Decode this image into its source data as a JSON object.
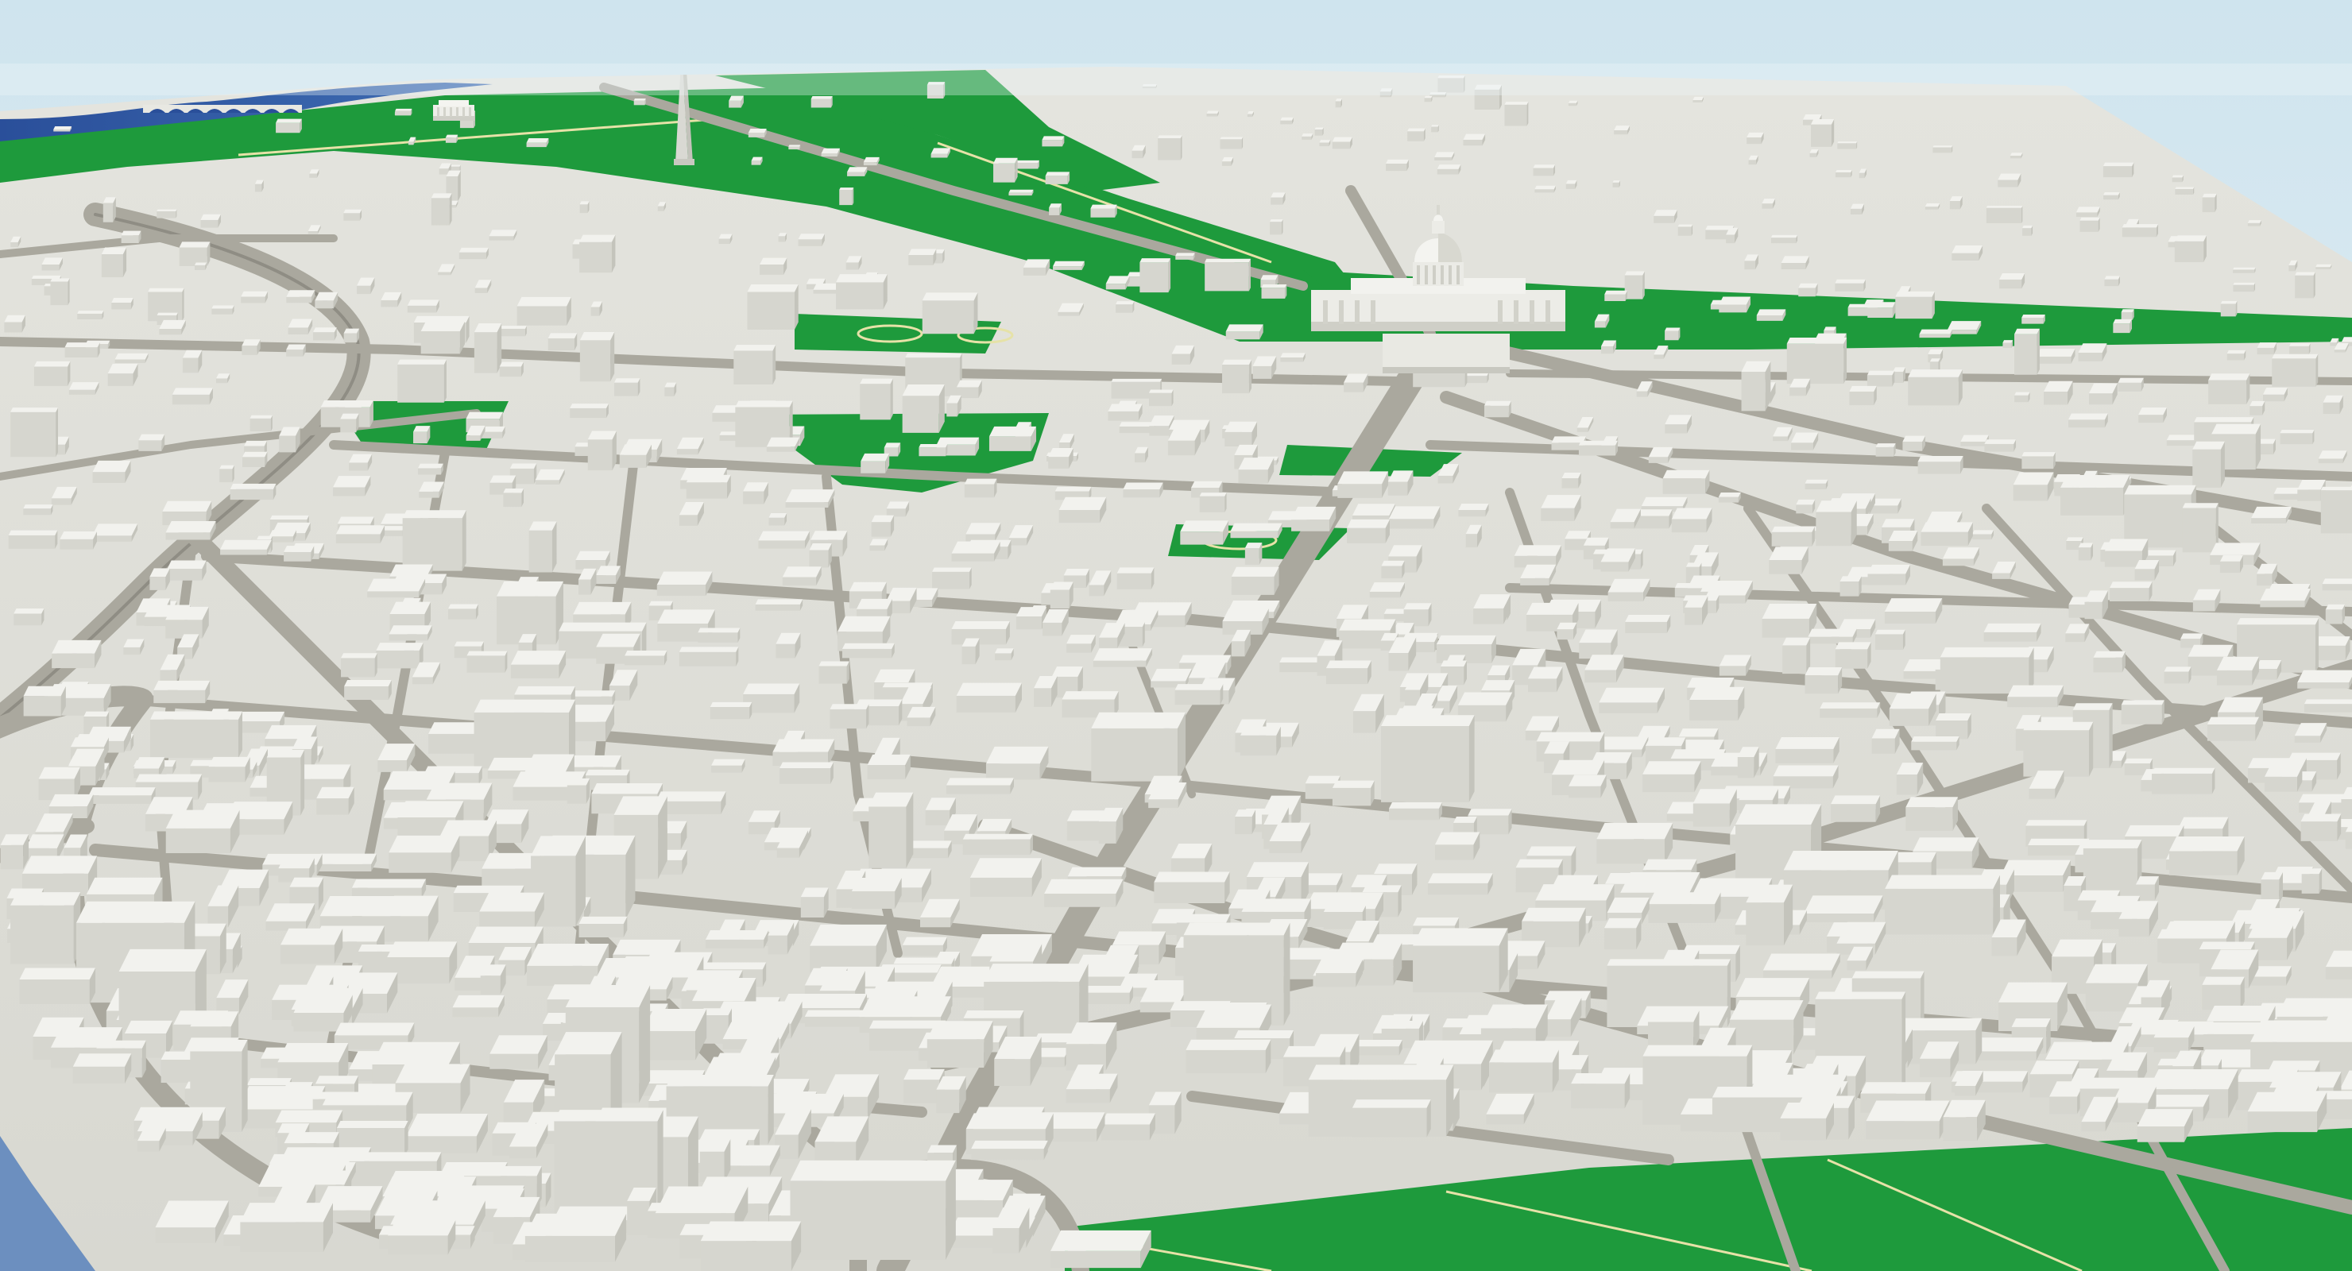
{
  "scene": {
    "type": "3d-city-map-render",
    "text": []
  },
  "colors": {
    "sky_top": "#cfe4ee",
    "sky_bottom": "#eef5f8",
    "ground": "#dcdcd5",
    "road": "#aaa89e",
    "road_edge": "#9c9a90",
    "park": "#1e9a3c",
    "park_light": "#2fae4a",
    "park_path": "#e6e2a8",
    "water": "#2a4f9a",
    "water_light": "#4f7fc0",
    "building_top": "#f2f2ee",
    "building_left": "#d6d6cf",
    "building_right": "#c4c4bc"
  },
  "landmarks": [
    {
      "name": "obelisk-monument"
    },
    {
      "name": "capitol-dome"
    },
    {
      "name": "memorial-temple"
    },
    {
      "name": "arched-bridge"
    }
  ]
}
